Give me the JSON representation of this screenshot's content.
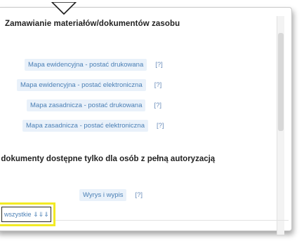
{
  "popup": {
    "title": "Zamawianie materiałów/dokumentów zasobu",
    "items": [
      {
        "label": "Mapa ewidencyjna - postać drukowana",
        "help": "[?]"
      },
      {
        "label": "Mapa ewidencyjna - postać elektroniczna",
        "help": "[?]"
      },
      {
        "label": "Mapa zasadnicza - postać drukowana",
        "help": "[?]"
      },
      {
        "label": "Mapa zasadnicza - postać elektroniczna",
        "help": "[?]"
      }
    ],
    "restricted_heading": "i dokumenty dostępne tylko dla osób z pełną autoryzacją",
    "restricted_items": [
      {
        "label": "Wyrys i wypis",
        "help": "[?]"
      }
    ],
    "show_all_label": "wszystkie ⇓⇓⇓"
  }
}
